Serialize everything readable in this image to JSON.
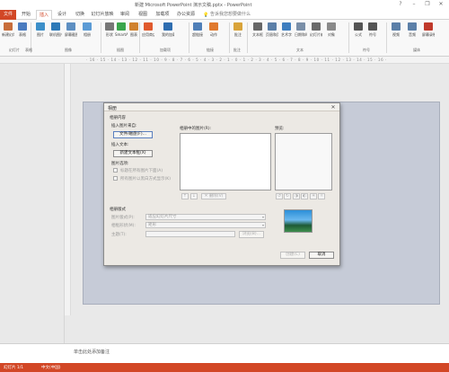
{
  "window": {
    "title": "新建 Microsoft PowerPoint 演示文稿.pptx - PowerPoint",
    "controls": [
      "?",
      "–",
      "❐",
      "✕"
    ]
  },
  "tabs": [
    "开始",
    "插入",
    "设计",
    "切换",
    "幻灯片放映",
    "审阅",
    "视图",
    "加载项",
    "办公资源"
  ],
  "tabs_file": "文件",
  "tell_me": "告诉我您想要做什么",
  "ribbon": {
    "buttons": [
      {
        "label": "新建幻灯片",
        "color": "#c86d3a"
      },
      {
        "label": "表格",
        "color": "#4a7bbf"
      },
      {
        "label": "图片",
        "color": "#3c8fc9"
      },
      {
        "label": "联机图片",
        "color": "#2e7ab8"
      },
      {
        "label": "屏幕截图",
        "color": "#5d8fc2"
      },
      {
        "label": "相册",
        "color": "#5b9bd5"
      },
      {
        "label": "形状",
        "color": "#777777"
      },
      {
        "label": "SmartArt",
        "color": "#3aa64c"
      },
      {
        "label": "图表",
        "color": "#d0822e"
      },
      {
        "label": "应用商店",
        "color": "#e05a2d"
      },
      {
        "label": "我的加载项",
        "color": "#2e6db0"
      },
      {
        "label": "超链接",
        "color": "#4f7fb8"
      },
      {
        "label": "动作",
        "color": "#e07a2e"
      },
      {
        "label": "批注",
        "color": "#d9a43a"
      },
      {
        "label": "文本框",
        "color": "#666666"
      },
      {
        "label": "页眉和页脚",
        "color": "#5b7fa8"
      },
      {
        "label": "艺术字",
        "color": "#3e7ebf"
      },
      {
        "label": "日期和时间",
        "color": "#7a8fa8"
      },
      {
        "label": "幻灯片编号",
        "color": "#6b6b6b"
      },
      {
        "label": "对象",
        "color": "#8a8a8a"
      },
      {
        "label": "公式",
        "color": "#555555"
      },
      {
        "label": "符号",
        "color": "#555555"
      },
      {
        "label": "视频",
        "color": "#5b7fa8"
      },
      {
        "label": "音频",
        "color": "#5b7fa8"
      },
      {
        "label": "屏幕录制",
        "color": "#c0392b"
      }
    ],
    "groups": [
      "幻灯片",
      "表格",
      "图像",
      "插图",
      "加载项",
      "链接",
      "批注",
      "文本",
      "符号",
      "媒体"
    ]
  },
  "ruler": "· 16 · 15 · 14 · 13 · 12 · 11 · 10 · 9 · 8 · 7 · 6 · 5 · 4 · 3 · 2 · 1 · 0 · 1 · 2 · 3 · 4 · 5 · 6 · 7 · 8 · 9 · 10 · 11 · 12 · 13 · 14 · 15 · 16 ·",
  "dialog": {
    "title": "相册",
    "close": "✕",
    "album_content": "相册内容",
    "insert_from": "插入图片来自:",
    "file_disk_button": "文件/磁盘(F)...",
    "insert_text": "插入文本:",
    "new_textbox_button": "新建文本框(X)",
    "picture_options": "图片选项:",
    "caption_below": "标题在所有图片下面(A)",
    "all_black_white": "所有图片以黑白方式显示(K)",
    "pictures_in_album": "相册中的图片(R):",
    "preview": "预览:",
    "remove_button": "删除(V)",
    "album_layout": "相册版式",
    "picture_layout_label": "图片版式(P):",
    "picture_layout_value": "适应幻灯片尺寸",
    "frame_shape_label": "相框形状(M):",
    "frame_shape_value": "矩形",
    "theme_label": "主题(T):",
    "theme_value": "",
    "browse_button": "浏览(B)...",
    "create_button": "创建(C)",
    "cancel_button": "取消"
  },
  "notes": "单击此处添加备注",
  "status": {
    "slide": "幻灯片 1/1",
    "language": "中文(中国)"
  },
  "colors": {
    "accent": "#d24726",
    "slide_bg": "#c6cbd7"
  }
}
